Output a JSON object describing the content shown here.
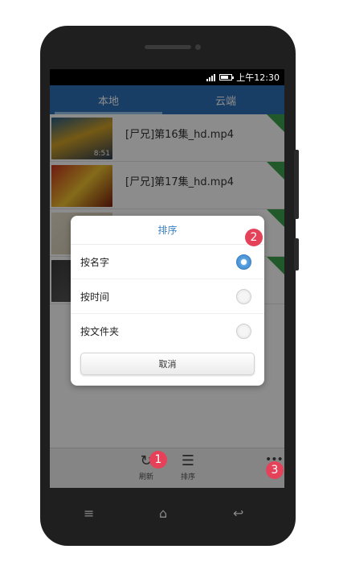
{
  "status_bar": {
    "time": "上午12:30"
  },
  "tabs": [
    {
      "label": "本地",
      "active": true
    },
    {
      "label": "云端",
      "active": false
    }
  ],
  "files": [
    {
      "name": "[尸兄]第16集_hd.mp4",
      "duration": "8:51",
      "new": true
    },
    {
      "name": "[尸兄]第17集_hd.mp4",
      "duration": "",
      "new": true
    },
    {
      "name": "",
      "duration": "",
      "new": true
    },
    {
      "name": "",
      "duration": "",
      "new": true
    }
  ],
  "dialog": {
    "title": "排序",
    "options": [
      {
        "label": "按名字",
        "checked": true
      },
      {
        "label": "按时间",
        "checked": false
      },
      {
        "label": "按文件夹",
        "checked": false
      }
    ],
    "cancel_label": "取消"
  },
  "toolbar": {
    "refresh_label": "刷新",
    "sort_label": "排序",
    "more_icon": "more-icon"
  },
  "callouts": [
    "1",
    "2",
    "3"
  ],
  "colors": {
    "tab_bar": "#2f72b8",
    "accent": "#3d82c4",
    "badge": "#e5425a",
    "new_ribbon": "#3fa34d"
  }
}
